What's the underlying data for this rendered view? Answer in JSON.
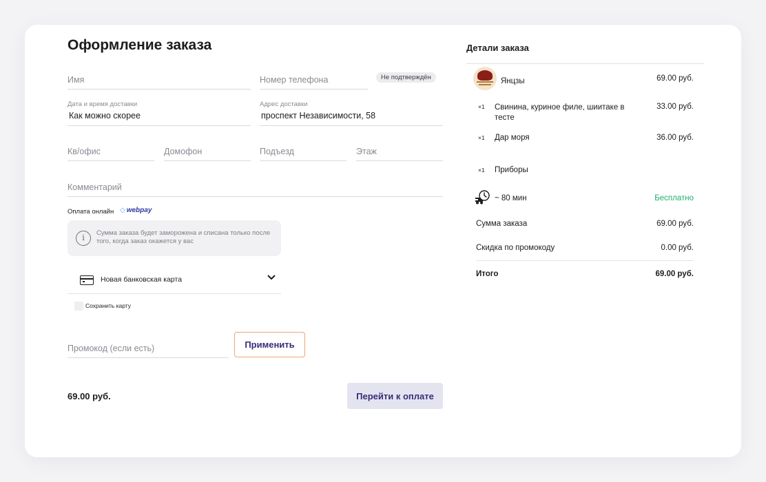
{
  "form": {
    "title": "Оформление заказа",
    "name_placeholder": "Имя",
    "phone_placeholder": "Номер телефона",
    "phone_badge": "Не подтверждён",
    "datetime_label": "Дата и время доставки",
    "datetime_value": "Как можно скорее",
    "address_label": "Адрес доставки",
    "address_value": "проспект Независимости, 58",
    "apt_placeholder": "Кв/офис",
    "intercom_placeholder": "Домофон",
    "entrance_placeholder": "Подъезд",
    "floor_placeholder": "Этаж",
    "comment_placeholder": "Комментарий"
  },
  "payment": {
    "label": "Оплата онлайн",
    "provider": "webpay",
    "info_text": "Сумма заказа будет заморожена и списана только после того, когда заказ окажется у вас",
    "card_option": "Новая банковская карта",
    "save_card_label": "Сохранить карту"
  },
  "promo": {
    "placeholder": "Промокод (если есть)",
    "apply_label": "Применить"
  },
  "footer": {
    "total": "69.00 руб.",
    "pay_button": "Перейти к оплате"
  },
  "details": {
    "title": "Детали заказа",
    "restaurant": {
      "name": "Янцзы",
      "price": "69.00 руб."
    },
    "items": [
      {
        "qty": "×1",
        "name": "Свинина, куриное филе, шиитаке в тесте",
        "price": "33.00 руб."
      },
      {
        "qty": "×1",
        "name": "Дар моря",
        "price": "36.00 руб."
      },
      {
        "qty": "×1",
        "name": "Приборы",
        "price": ""
      }
    ],
    "delivery_time": "~ 80 мин",
    "delivery_price": "Бесплатно",
    "subtotal_label": "Сумма заказа",
    "subtotal_value": "69.00 руб.",
    "discount_label": "Скидка по промокоду",
    "discount_value": "0.00 руб.",
    "total_label": "Итого",
    "total_value": "69.00 руб."
  },
  "colors": {
    "accent_text": "#3a2a78",
    "apply_border": "#f0a277",
    "free_green": "#1fae6e"
  }
}
